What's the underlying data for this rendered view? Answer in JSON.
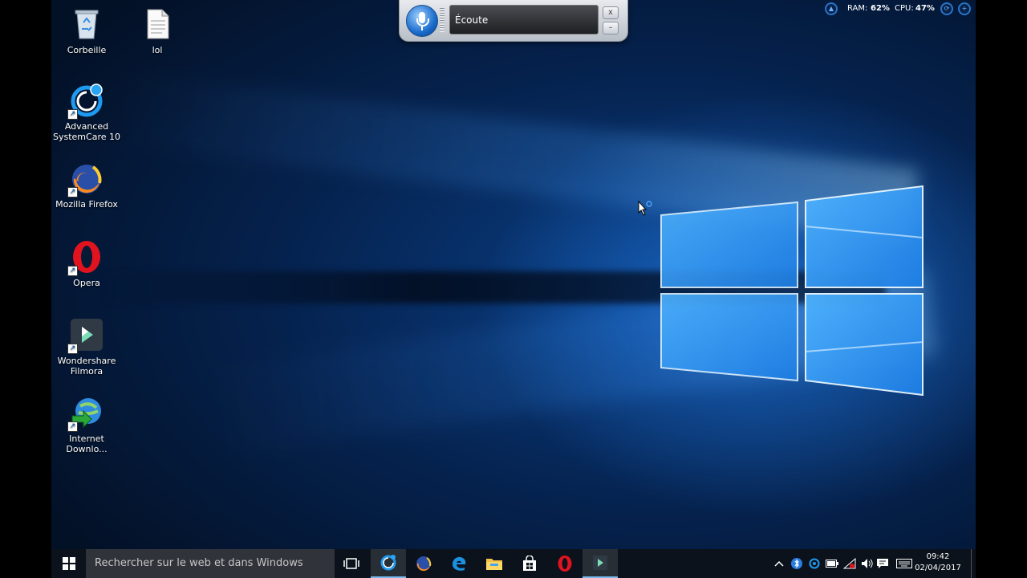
{
  "desktop": {
    "icons": [
      {
        "label": "Corbeille",
        "icon": "recycle-bin-icon"
      },
      {
        "label": "lol",
        "icon": "text-file-icon"
      },
      {
        "label": "Advanced SystemCare 10",
        "icon": "advanced-systemcare-icon"
      },
      {
        "label": "Mozilla Firefox",
        "icon": "firefox-icon"
      },
      {
        "label": "Opera",
        "icon": "opera-icon"
      },
      {
        "label": "Wondershare Filmora",
        "icon": "filmora-icon"
      },
      {
        "label": "Internet Downlo...",
        "icon": "internet-download-manager-icon"
      }
    ]
  },
  "speech_widget": {
    "status": "Écoute",
    "close_label": "x",
    "minimize_label": "–"
  },
  "system_meter": {
    "ram_label": "RAM:",
    "ram_value": "62%",
    "cpu_label": "CPU:",
    "cpu_value": "47%"
  },
  "taskbar": {
    "search_placeholder": "Rechercher sur le web et dans Windows",
    "apps": [
      "task-view-icon",
      "advanced-systemcare-icon",
      "firefox-icon",
      "edge-icon",
      "file-explorer-icon",
      "store-icon",
      "opera-icon",
      "filmora-icon"
    ],
    "active_app": "advanced-systemcare-icon",
    "tray": [
      "chevron-up-icon",
      "bluetooth-icon",
      "systemcare-tray-icon",
      "battery-icon",
      "network-icon",
      "volume-icon",
      "notifications-icon",
      "keyboard-icon"
    ],
    "time": "09:42",
    "date": "02/04/2017"
  },
  "colors": {
    "accent": "#76b9ed",
    "taskbar": "#0b121b",
    "desktop_blue": "#0a3f86"
  }
}
